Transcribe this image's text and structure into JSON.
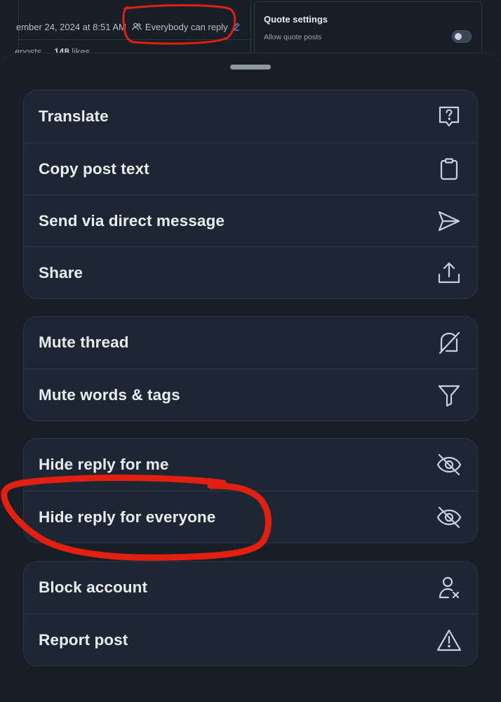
{
  "background_post": {
    "date_text": "ember 24, 2024 at 8:51 AM",
    "reply_setting": "Everybody can reply",
    "stats": {
      "reposts_label": "eposts",
      "likes_count": "148",
      "likes_label": "likes"
    }
  },
  "quote_settings": {
    "title": "Quote settings",
    "allow_label": "Allow quote posts",
    "allow_enabled": false
  },
  "menu": {
    "group1": [
      {
        "label": "Translate",
        "icon": "translate-icon"
      },
      {
        "label": "Copy post text",
        "icon": "clipboard-icon"
      },
      {
        "label": "Send via direct message",
        "icon": "send-icon"
      },
      {
        "label": "Share",
        "icon": "share-icon"
      }
    ],
    "group2": [
      {
        "label": "Mute thread",
        "icon": "bell-muted-icon"
      },
      {
        "label": "Mute words & tags",
        "icon": "filter-icon"
      }
    ],
    "group3": [
      {
        "label": "Hide reply for me",
        "icon": "eye-off-icon"
      },
      {
        "label": "Hide reply for everyone",
        "icon": "eye-off-icon"
      }
    ],
    "group4": [
      {
        "label": "Block account",
        "icon": "person-x-icon"
      },
      {
        "label": "Report post",
        "icon": "warning-icon"
      }
    ]
  },
  "colors": {
    "sheet_bg": "#161e27",
    "group_bg": "#1d2733",
    "text": "#e7edf3",
    "annotation": "#e3200f"
  }
}
